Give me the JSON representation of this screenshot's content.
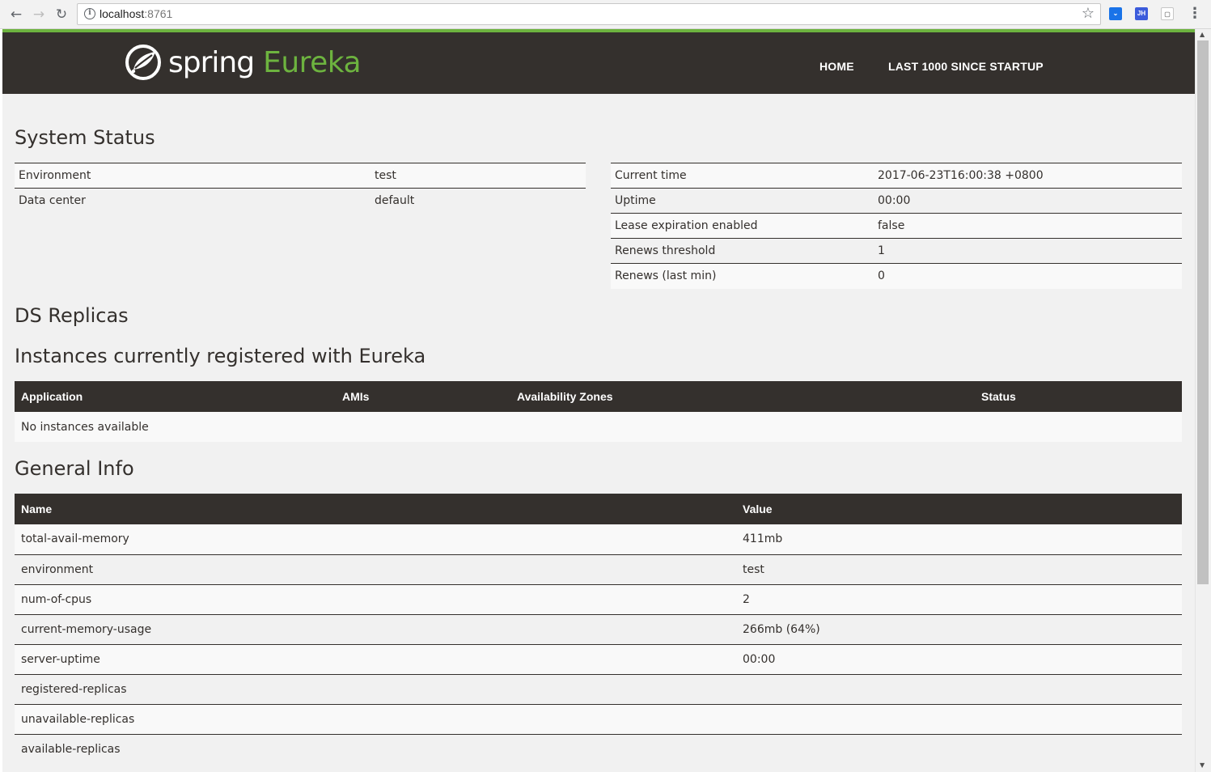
{
  "browser": {
    "url_host": "localhost",
    "url_port": ":8761",
    "extensions": [
      "pocket-icon",
      "JH",
      "doc-icon"
    ]
  },
  "brand": {
    "spring": "spring",
    "eureka": "Eureka",
    "accent_color": "#6db33f",
    "dark_color": "#34302d"
  },
  "nav": {
    "home": "HOME",
    "last1000": "LAST 1000 SINCE STARTUP"
  },
  "system_status": {
    "title": "System Status",
    "left": [
      {
        "key": "Environment",
        "value": "test"
      },
      {
        "key": "Data center",
        "value": "default"
      }
    ],
    "right": [
      {
        "key": "Current time",
        "value": "2017-06-23T16:00:38 +0800"
      },
      {
        "key": "Uptime",
        "value": "00:00"
      },
      {
        "key": "Lease expiration enabled",
        "value": "false"
      },
      {
        "key": "Renews threshold",
        "value": "1"
      },
      {
        "key": "Renews (last min)",
        "value": "0"
      }
    ]
  },
  "ds_replicas": {
    "title": "DS Replicas"
  },
  "instances": {
    "title": "Instances currently registered with Eureka",
    "headers": [
      "Application",
      "AMIs",
      "Availability Zones",
      "Status"
    ],
    "empty": "No instances available"
  },
  "general_info": {
    "title": "General Info",
    "headers": [
      "Name",
      "Value"
    ],
    "rows": [
      {
        "name": "total-avail-memory",
        "value": "411mb"
      },
      {
        "name": "environment",
        "value": "test"
      },
      {
        "name": "num-of-cpus",
        "value": "2"
      },
      {
        "name": "current-memory-usage",
        "value": "266mb (64%)"
      },
      {
        "name": "server-uptime",
        "value": "00:00"
      },
      {
        "name": "registered-replicas",
        "value": ""
      },
      {
        "name": "unavailable-replicas",
        "value": ""
      },
      {
        "name": "available-replicas",
        "value": ""
      }
    ]
  }
}
